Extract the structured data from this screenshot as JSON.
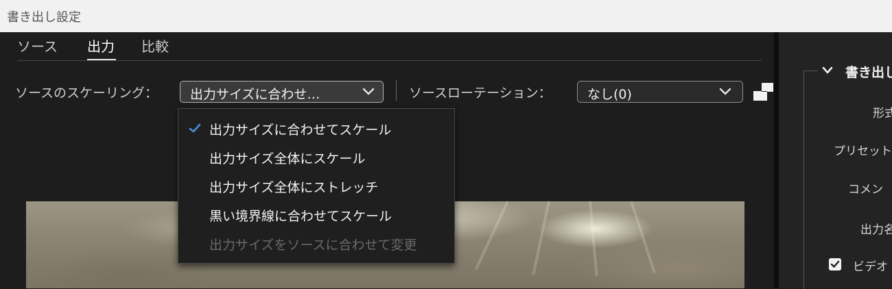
{
  "window": {
    "title": "書き出し設定"
  },
  "tabs": [
    {
      "label": "ソース"
    },
    {
      "label": "出力",
      "active": true
    },
    {
      "label": "比較"
    }
  ],
  "scaling": {
    "label": "ソースのスケーリング：",
    "selected": "出力サイズに合わせ…",
    "icon": "chevron-down-icon"
  },
  "rotation": {
    "label": "ソースローテーション：",
    "selected": "なし(0)",
    "icon": "chevron-down-icon"
  },
  "scaling_menu": {
    "items": [
      {
        "label": "出力サイズに合わせてスケール",
        "checked": true,
        "enabled": true
      },
      {
        "label": "出力サイズ全体にスケール",
        "checked": false,
        "enabled": true
      },
      {
        "label": "出力サイズ全体にストレッチ",
        "checked": false,
        "enabled": true
      },
      {
        "label": "黒い境界線に合わせてスケール",
        "checked": false,
        "enabled": true
      },
      {
        "label": "出力サイズをソースに合わせて変更",
        "checked": false,
        "enabled": false
      }
    ],
    "check_icon": "checkmark-icon",
    "accent_color": "#4a90e2"
  },
  "right_panel": {
    "section_title": "書き出し",
    "labels": {
      "format": "形式",
      "preset": "プリセット",
      "comment": "コメン",
      "output": "出力名"
    },
    "video_checkbox": {
      "label": "ビデオ",
      "checked": true
    }
  }
}
